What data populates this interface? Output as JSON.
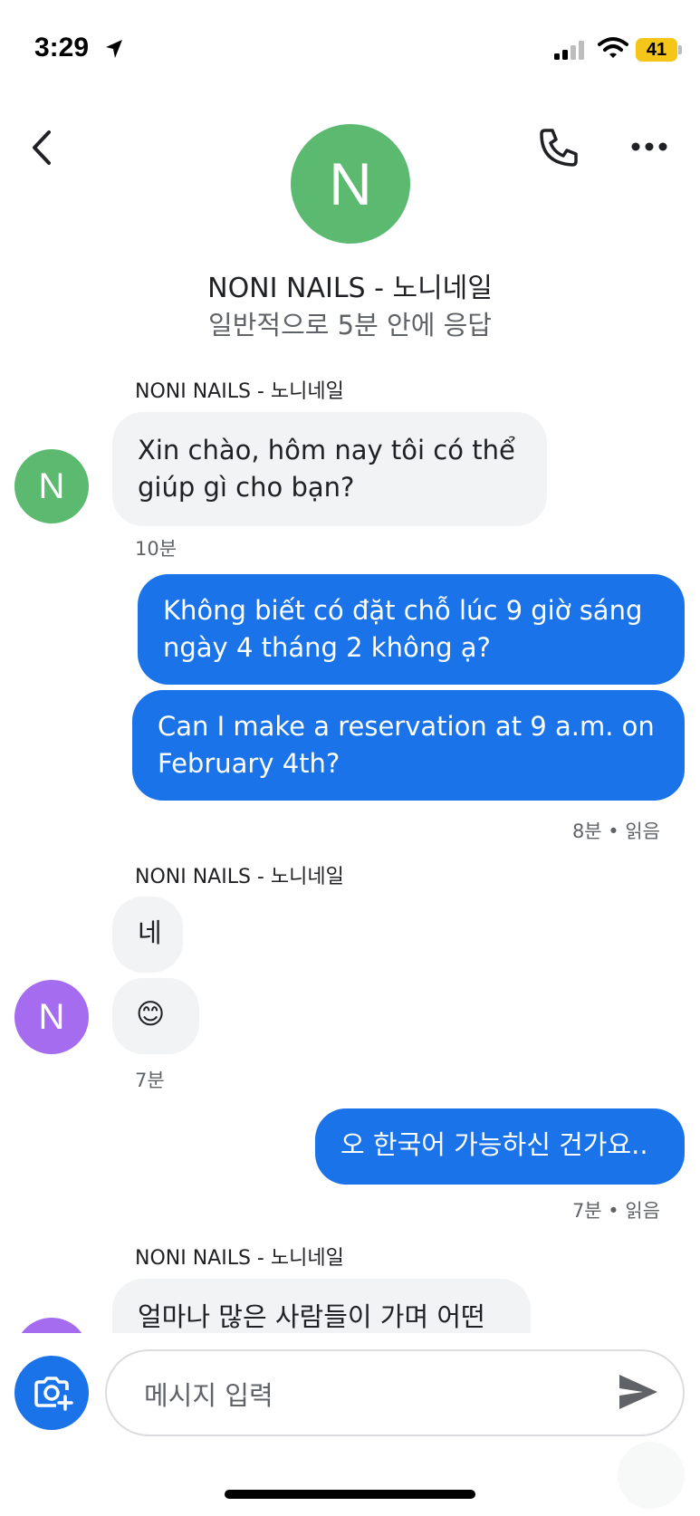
{
  "status_bar": {
    "time": "3:29",
    "battery": "41"
  },
  "header": {
    "avatar_letter": "N",
    "contact_name": "NONI NAILS - 노니네일",
    "subtitle": "일반적으로 5분 안에 응답"
  },
  "messages": [
    {
      "sender": "NONI NAILS - 노니네일",
      "avatar": "N",
      "bubbles": [
        "Xin chào, hôm nay tôi có thể giúp gì cho bạn?"
      ],
      "meta": "10분"
    },
    {
      "outgoing": true,
      "bubbles": [
        "Không biết có đặt chỗ lúc 9 giờ sáng ngày 4 tháng 2 không ạ?",
        "Can I make a reservation at 9 a.m. on February 4th?"
      ],
      "meta": "8분 • 읽음"
    },
    {
      "sender": "NONI NAILS - 노니네일",
      "avatar": "N",
      "bubbles": [
        "네",
        "😊"
      ],
      "meta": "7분"
    },
    {
      "outgoing": true,
      "bubbles": [
        "오 한국어 가능하신 건가요.."
      ],
      "meta": "7분 • 읽음"
    },
    {
      "sender": "NONI NAILS - 노니네일",
      "avatar": "N",
      "bubbles": [
        "얼마나 많은 사람들이 가며 어떤 서"
      ]
    }
  ],
  "composer": {
    "placeholder": "메시지 입력"
  },
  "colors": {
    "accent": "#1a73e8",
    "avatar_green": "#5bba6f",
    "avatar_purple": "#a56cef",
    "incoming_bubble": "#f1f3f4"
  },
  "icons": [
    "location-arrow-icon",
    "signal-icon",
    "wifi-icon",
    "back-arrow-icon",
    "phone-icon",
    "more-icon",
    "camera-add-icon",
    "send-icon"
  ]
}
